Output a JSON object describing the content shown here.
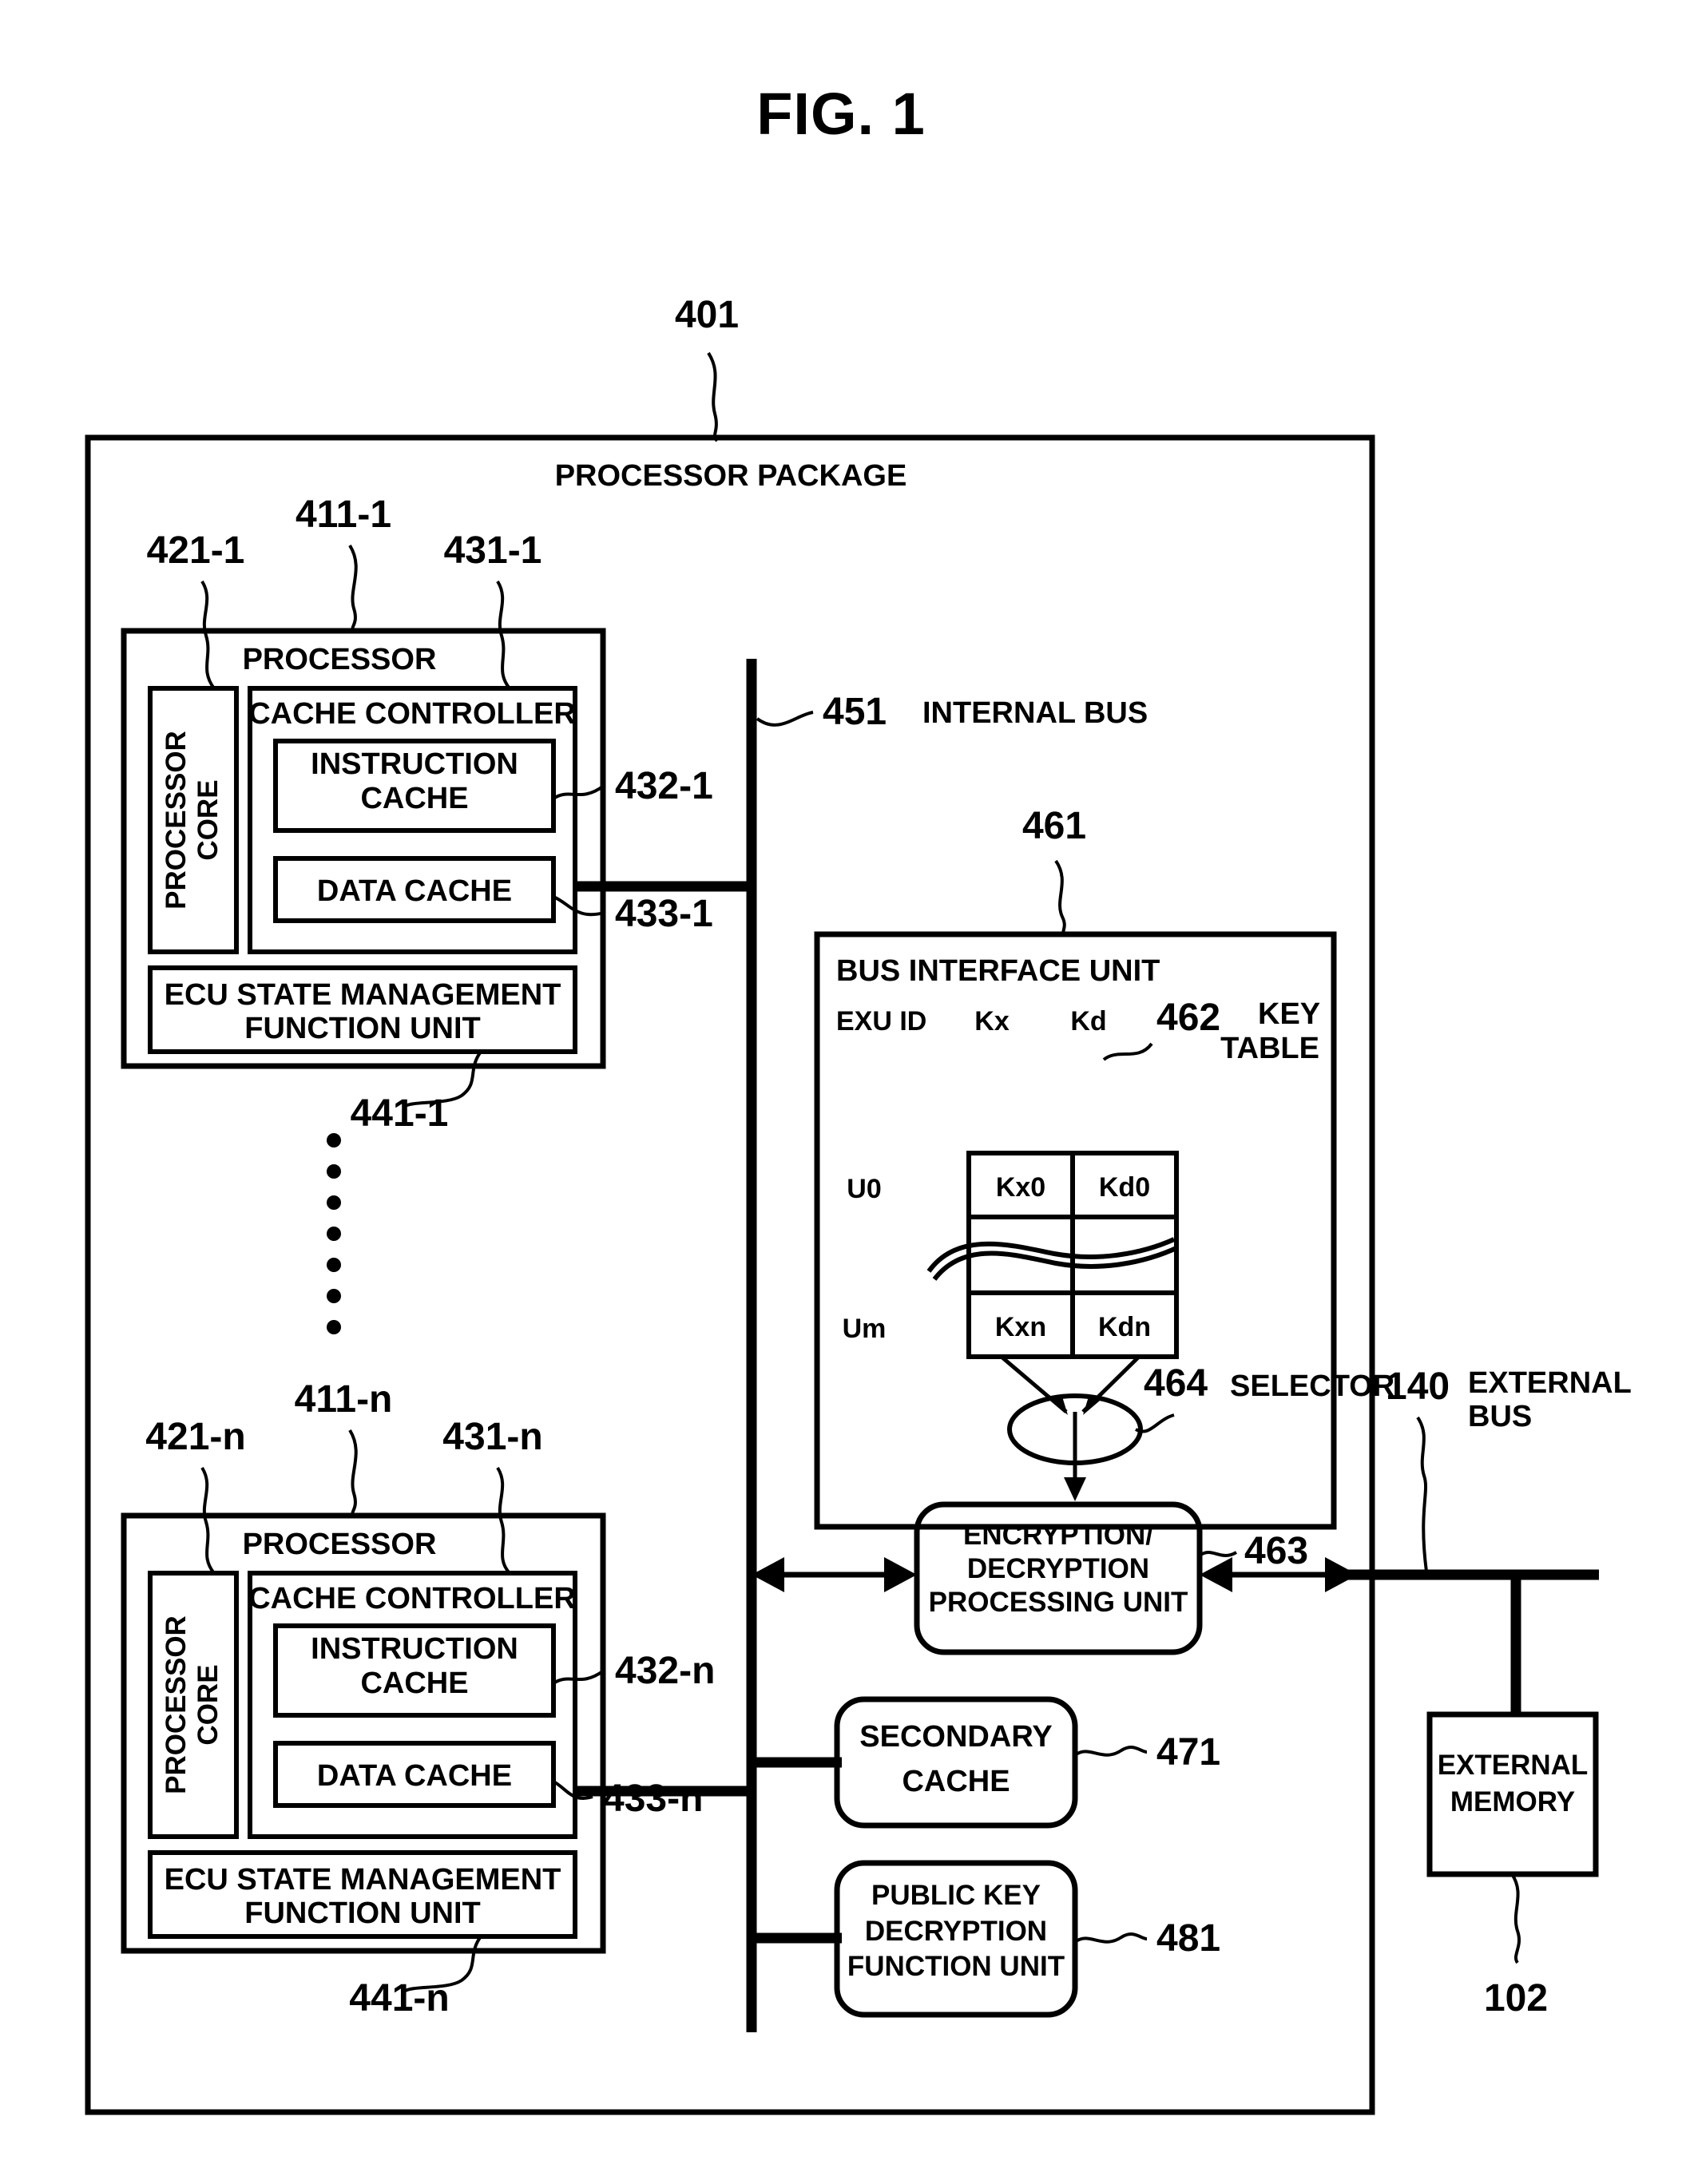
{
  "figure": {
    "title": "FIG. 1"
  },
  "package": {
    "ref": "401",
    "label": "PROCESSOR PACKAGE"
  },
  "internal_bus": {
    "ref": "451",
    "label": "INTERNAL BUS"
  },
  "external_bus": {
    "ref": "140",
    "label_line1": "EXTERNAL",
    "label_line2": "BUS"
  },
  "external_memory": {
    "ref": "102",
    "label_line1": "EXTERNAL",
    "label_line2": "MEMORY"
  },
  "processors": [
    {
      "ref_processor": "411-1",
      "ref_core": "421-1",
      "ref_cache_controller": "431-1",
      "ref_instruction_cache": "432-1",
      "ref_data_cache": "433-1",
      "ref_ecu_unit": "441-1",
      "label_processor": "PROCESSOR",
      "label_core_line1": "PROCESSOR",
      "label_core_line2": "CORE",
      "label_cache_controller": "CACHE CONTROLLER",
      "label_instruction_cache_line1": "INSTRUCTION",
      "label_instruction_cache_line2": "CACHE",
      "label_data_cache": "DATA CACHE",
      "label_ecu_line1": "ECU STATE MANAGEMENT",
      "label_ecu_line2": "FUNCTION UNIT"
    },
    {
      "ref_processor": "411-n",
      "ref_core": "421-n",
      "ref_cache_controller": "431-n",
      "ref_instruction_cache": "432-n",
      "ref_data_cache": "433-n",
      "ref_ecu_unit": "441-n",
      "label_processor": "PROCESSOR",
      "label_core_line1": "PROCESSOR",
      "label_core_line2": "CORE",
      "label_cache_controller": "CACHE CONTROLLER",
      "label_instruction_cache_line1": "INSTRUCTION",
      "label_instruction_cache_line2": "CACHE",
      "label_data_cache": "DATA CACHE",
      "label_ecu_line1": "ECU STATE MANAGEMENT",
      "label_ecu_line2": "FUNCTION UNIT"
    }
  ],
  "bus_interface_unit": {
    "ref": "461",
    "label": "BUS INTERFACE UNIT",
    "key_table": {
      "ref": "462",
      "label_line1": "KEY",
      "label_line2": "TABLE",
      "columns": [
        "EXU ID",
        "Kx",
        "Kd"
      ],
      "rows": [
        {
          "id": "U0",
          "kx": "Kx0",
          "kd": "Kd0"
        },
        {
          "id": "Um",
          "kx": "Kxn",
          "kd": "Kdn"
        }
      ]
    },
    "selector": {
      "ref": "464",
      "label": "SELECTOR"
    },
    "crypto_unit": {
      "ref": "463",
      "label_line1": "ENCRYPTION/",
      "label_line2": "DECRYPTION",
      "label_line3": "PROCESSING UNIT"
    }
  },
  "secondary_cache": {
    "ref": "471",
    "label_line1": "SECONDARY",
    "label_line2": "CACHE"
  },
  "public_key_unit": {
    "ref": "481",
    "label_line1": "PUBLIC KEY",
    "label_line2": "DECRYPTION",
    "label_line3": "FUNCTION UNIT"
  },
  "ellipsis": {
    "count": 7
  }
}
